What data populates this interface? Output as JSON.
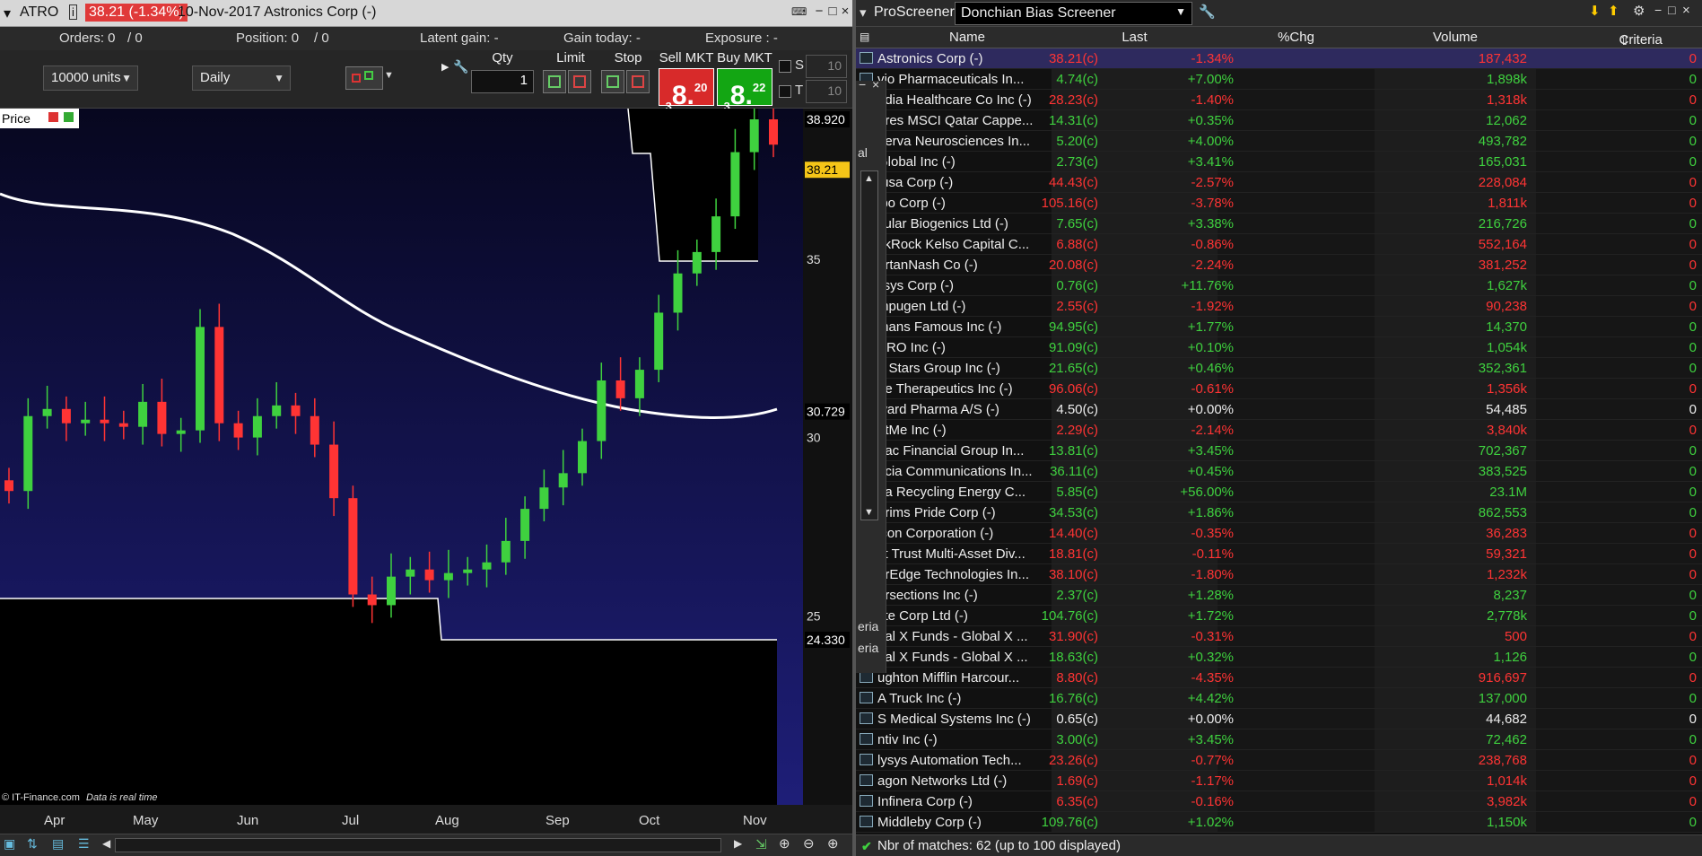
{
  "chart_window": {
    "symbol": "ATRO",
    "price_change": "38.21 (-1.34%)",
    "title": "10-Nov-2017 Astronics Corp (-)",
    "orders_label": "Orders: 0",
    "orders_value": "/ 0",
    "position_label": "Position: 0",
    "position_value": "/ 0",
    "latent_gain": "Latent gain: -",
    "gain_today": "Gain today: -",
    "exposure": "Exposure : -",
    "units_select": "10000 units",
    "period_select": "Daily",
    "qty_label": "Qty",
    "qty_value": "1",
    "limit_label": "Limit",
    "stop_label": "Stop",
    "sell_label": "Sell MKT",
    "buy_label": "Buy MKT",
    "sell_price": {
      "lead": "3",
      "main": "8.",
      "tail": "20"
    },
    "buy_price": {
      "lead": "3",
      "main": "8.",
      "tail": "22"
    },
    "s_label": "S",
    "t_label": "T",
    "s_value": "10",
    "t_value": "10",
    "price_panel_label": "Price",
    "credit": "© IT-Finance.com",
    "realtime": "Data is real time"
  },
  "chart_data": {
    "type": "candlestick",
    "title": "10-Nov-2017 Astronics Corp (-)",
    "x_tick_labels": [
      "Apr",
      "May",
      "Jun",
      "Jul",
      "Aug",
      "Sep",
      "Oct",
      "Nov"
    ],
    "y_tick_labels": [
      "25",
      "30",
      "35"
    ],
    "y_range": [
      24.33,
      38.92
    ],
    "price_labels": {
      "high": "38.920",
      "last": "38.21",
      "ma": "30.729",
      "low": "24.330"
    },
    "series": [
      {
        "name": "Price",
        "approx_close": [
          28.5,
          30.6,
          30.8,
          30.4,
          30.5,
          30.4,
          30.3,
          31.0,
          30.1,
          30.2,
          33.1,
          30.4,
          30.0,
          30.6,
          30.9,
          30.6,
          29.8,
          28.3,
          25.6,
          25.3,
          26.1,
          26.3,
          26.0,
          26.2,
          26.3,
          26.5,
          27.1,
          28.0,
          28.6,
          29.0,
          29.9,
          31.6,
          31.1,
          31.9,
          33.5,
          34.6,
          35.2,
          36.2,
          38.0,
          38.92,
          38.21
        ]
      }
    ]
  },
  "screener": {
    "title": "ProScreener",
    "selected": "Donchian Bias Screener",
    "columns": [
      "Name",
      "Last",
      "%Chg",
      "Volume",
      "Criteria"
    ],
    "rows": [
      {
        "name": "Astronics Corp (-)",
        "last": "38.21(c)",
        "chg": "-1.34%",
        "vol": "187,432",
        "crit": "0"
      },
      {
        "name": "vio Pharmaceuticals In...",
        "last": "4.74(c)",
        "chg": "+7.00%",
        "vol": "1,898k",
        "crit": "0"
      },
      {
        "name": "ndia Healthcare Co Inc (-)",
        "last": "28.23(c)",
        "chg": "-1.40%",
        "vol": "1,318k",
        "crit": "0"
      },
      {
        "name": "ares MSCI Qatar Cappe...",
        "last": "14.31(c)",
        "chg": "+0.35%",
        "vol": "12,062",
        "crit": "0"
      },
      {
        "name": "nerva Neurosciences In...",
        "last": "5.20(c)",
        "chg": "+4.00%",
        "vol": "493,782",
        "crit": "0"
      },
      {
        "name": "Global Inc (-)",
        "last": "2.73(c)",
        "chg": "+3.41%",
        "vol": "165,031",
        "crit": "0"
      },
      {
        "name": "tusa Corp (-)",
        "last": "44.43(c)",
        "chg": "-2.57%",
        "vol": "228,084",
        "crit": "0"
      },
      {
        "name": "ibo Corp (-)",
        "last": "105.16(c)",
        "chg": "-3.78%",
        "vol": "1,811k",
        "crit": "0"
      },
      {
        "name": "cular Biogenics Ltd (-)",
        "last": "7.65(c)",
        "chg": "+3.38%",
        "vol": "216,726",
        "crit": "0"
      },
      {
        "name": "ckRock Kelso Capital C...",
        "last": "6.88(c)",
        "chg": "-0.86%",
        "vol": "552,164",
        "crit": "0"
      },
      {
        "name": "urtanNash Co (-)",
        "last": "20.08(c)",
        "chg": "-2.24%",
        "vol": "381,252",
        "crit": "0"
      },
      {
        "name": "lisys Corp (-)",
        "last": "0.76(c)",
        "chg": "+11.76%",
        "vol": "1,627k",
        "crit": "0"
      },
      {
        "name": "mpugen Ltd (-)",
        "last": "2.55(c)",
        "chg": "-1.92%",
        "vol": "90,238",
        "crit": "0"
      },
      {
        "name": "thans Famous Inc (-)",
        "last": "94.95(c)",
        "chg": "+1.77%",
        "vol": "14,370",
        "crit": "0"
      },
      {
        "name": "ARO Inc (-)",
        "last": "91.09(c)",
        "chg": "+0.10%",
        "vol": "1,054k",
        "crit": "0"
      },
      {
        "name": "e Stars Group Inc (-)",
        "last": "21.65(c)",
        "chg": "+0.46%",
        "vol": "352,361",
        "crit": "0"
      },
      {
        "name": "ge Therapeutics Inc (-)",
        "last": "96.06(c)",
        "chg": "-0.61%",
        "vol": "1,356k",
        "crit": "0"
      },
      {
        "name": "ward Pharma A/S (-)",
        "last": "4.50(c)",
        "chg": "+0.00%",
        "vol": "54,485",
        "crit": "0"
      },
      {
        "name": "etMe Inc (-)",
        "last": "2.29(c)",
        "chg": "-2.14%",
        "vol": "3,840k",
        "crit": "0"
      },
      {
        "name": "bac Financial Group In...",
        "last": "13.81(c)",
        "chg": "+3.45%",
        "vol": "702,367",
        "crit": "0"
      },
      {
        "name": "ncia Communications In...",
        "last": "36.11(c)",
        "chg": "+0.45%",
        "vol": "383,525",
        "crit": "0"
      },
      {
        "name": "na Recycling Energy C...",
        "last": "5.85(c)",
        "chg": "+56.00%",
        "vol": "23.1M",
        "crit": "0"
      },
      {
        "name": "grims Pride Corp (-)",
        "last": "34.53(c)",
        "chg": "+1.86%",
        "vol": "862,553",
        "crit": "0"
      },
      {
        "name": "icon Corporation (-)",
        "last": "14.40(c)",
        "chg": "-0.35%",
        "vol": "36,283",
        "crit": "0"
      },
      {
        "name": "st Trust Multi-Asset Div...",
        "last": "18.81(c)",
        "chg": "-0.11%",
        "vol": "59,321",
        "crit": "0"
      },
      {
        "name": "arEdge Technologies In...",
        "last": "38.10(c)",
        "chg": "-1.80%",
        "vol": "1,232k",
        "crit": "0"
      },
      {
        "name": "ersections Inc (-)",
        "last": "2.37(c)",
        "chg": "+1.28%",
        "vol": "8,237",
        "crit": "0"
      },
      {
        "name": "yte Corp Ltd (-)",
        "last": "104.76(c)",
        "chg": "+1.72%",
        "vol": "2,778k",
        "crit": "0"
      },
      {
        "name": "bal X Funds - Global X ...",
        "last": "31.90(c)",
        "chg": "-0.31%",
        "vol": "500",
        "crit": "0"
      },
      {
        "name": "bal X Funds - Global X ...",
        "last": "18.63(c)",
        "chg": "+0.32%",
        "vol": "1,126",
        "crit": "0"
      },
      {
        "name": "ughton Mifflin Harcour...",
        "last": "8.80(c)",
        "chg": "-4.35%",
        "vol": "916,697",
        "crit": "0"
      },
      {
        "name": "A Truck Inc (-)",
        "last": "16.76(c)",
        "chg": "+4.42%",
        "vol": "137,000",
        "crit": "0"
      },
      {
        "name": "S Medical Systems Inc (-)",
        "last": "0.65(c)",
        "chg": "+0.00%",
        "vol": "44,682",
        "crit": "0"
      },
      {
        "name": "ntiv Inc (-)",
        "last": "3.00(c)",
        "chg": "+3.45%",
        "vol": "72,462",
        "crit": "0"
      },
      {
        "name": "lysys Automation Tech...",
        "last": "23.26(c)",
        "chg": "-0.77%",
        "vol": "238,768",
        "crit": "0"
      },
      {
        "name": "agon Networks Ltd (-)",
        "last": "1.69(c)",
        "chg": "-1.17%",
        "vol": "1,014k",
        "crit": "0"
      },
      {
        "name": "Infinera Corp (-)",
        "last": "6.35(c)",
        "chg": "-0.16%",
        "vol": "3,982k",
        "crit": "0"
      },
      {
        "name": "Middleby Corp (-)",
        "last": "109.76(c)",
        "chg": "+1.02%",
        "vol": "1,150k",
        "crit": "0"
      }
    ],
    "status": "Nbr of matches: 62 (up to 100 displayed)",
    "overlay_texts": [
      "al",
      "eria",
      "eria"
    ]
  },
  "colors": {
    "up": "#3fd13f",
    "down": "#ff3434",
    "plot_bg_top": "#07071f",
    "plot_bg_bottom": "#1e1e78",
    "ma_line": "#ffffff"
  }
}
